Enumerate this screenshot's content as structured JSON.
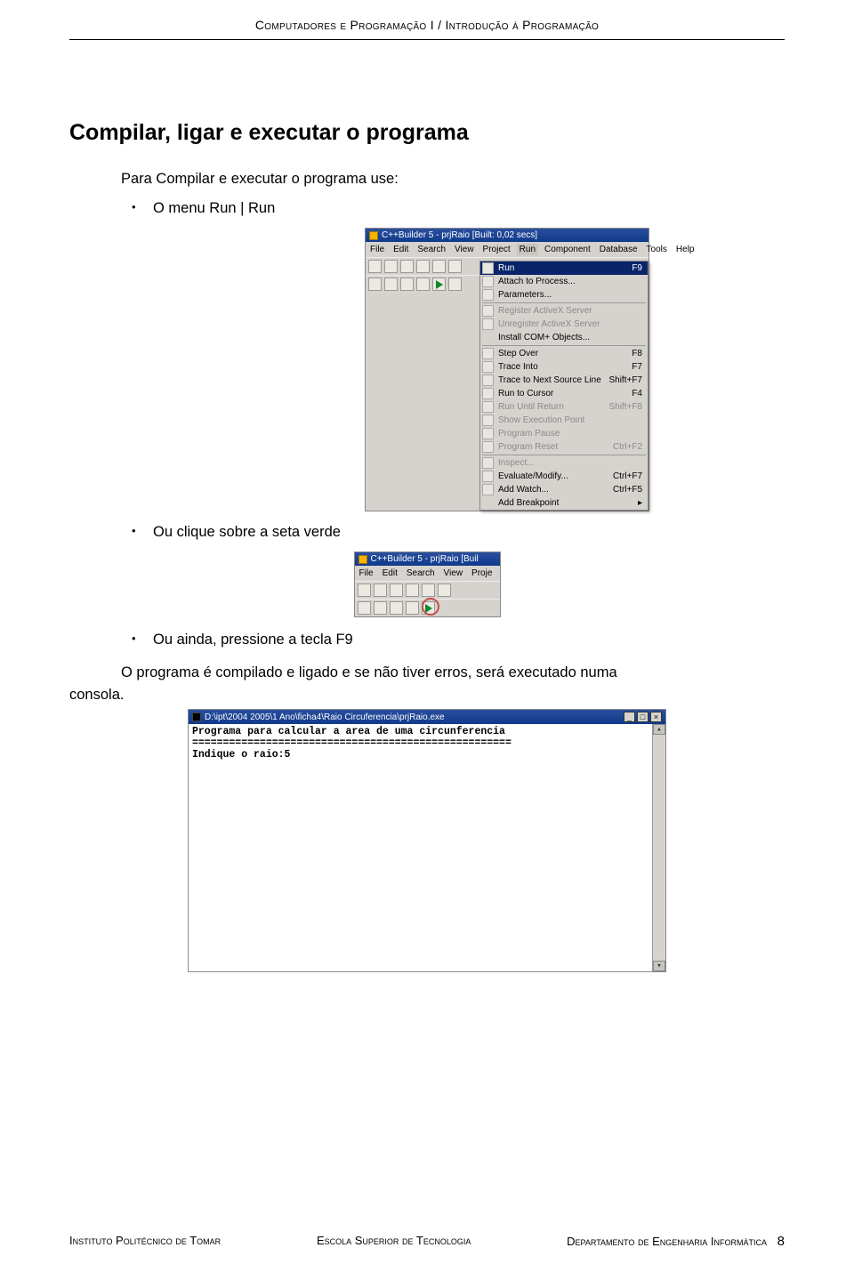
{
  "header": {
    "text": "Computadores e Programação I / Introdução à Programação"
  },
  "section": {
    "title": "Compilar, ligar e executar o programa",
    "intro": "Para Compilar e executar o programa use:",
    "bullet1": "O menu Run | Run",
    "bullet2": "Ou clique sobre a seta verde",
    "bullet3": "Ou ainda, pressione a tecla F9",
    "conclusion_pre": "O programa é compilado e ligado e se não tiver erros, será executado numa",
    "conclusion_last": "consola."
  },
  "runmenu": {
    "title": "C++Builder 5 - prjRaio [Built: 0,02 secs]",
    "menus": [
      "File",
      "Edit",
      "Search",
      "View",
      "Project",
      "Run",
      "Component",
      "Database",
      "Tools",
      "Help"
    ],
    "items": [
      {
        "label": "Run",
        "shortcut": "F9",
        "sel": true,
        "icon": true
      },
      {
        "label": "Attach to Process...",
        "icon": true
      },
      {
        "label": "Parameters...",
        "icon": true
      },
      {
        "sep": true
      },
      {
        "label": "Register ActiveX Server",
        "disabled": true,
        "icon": true
      },
      {
        "label": "Unregister ActiveX Server",
        "disabled": true,
        "icon": true
      },
      {
        "label": "Install COM+ Objects..."
      },
      {
        "sep": true
      },
      {
        "label": "Step Over",
        "shortcut": "F8",
        "icon": true
      },
      {
        "label": "Trace Into",
        "shortcut": "F7",
        "icon": true
      },
      {
        "label": "Trace to Next Source Line",
        "shortcut": "Shift+F7",
        "icon": true
      },
      {
        "label": "Run to Cursor",
        "shortcut": "F4",
        "icon": true
      },
      {
        "label": "Run Until Return",
        "shortcut": "Shift+F8",
        "disabled": true,
        "icon": true
      },
      {
        "label": "Show Execution Point",
        "disabled": true,
        "icon": true
      },
      {
        "label": "Program Pause",
        "disabled": true,
        "icon": true
      },
      {
        "label": "Program Reset",
        "shortcut": "Ctrl+F2",
        "disabled": true,
        "icon": true
      },
      {
        "sep": true
      },
      {
        "label": "Inspect...",
        "disabled": true,
        "icon": true
      },
      {
        "label": "Evaluate/Modify...",
        "shortcut": "Ctrl+F7",
        "icon": true
      },
      {
        "label": "Add Watch...",
        "shortcut": "Ctrl+F5",
        "icon": true
      },
      {
        "label": "Add Breakpoint",
        "arrow": true
      }
    ]
  },
  "smalltool": {
    "title": "C++Builder 5 - prjRaio [Buil",
    "menus": [
      "File",
      "Edit",
      "Search",
      "View",
      "Proje"
    ]
  },
  "console": {
    "title": "D:\\ipt\\2004 2005\\1 Ano\\ficha4\\Raio Circuferencia\\prjRaio.exe",
    "line1": "Programa para calcular a area de uma circunferencia",
    "line2": "====================================================",
    "line3": "Indique o raio:5"
  },
  "footer": {
    "left": "Instituto Politécnico de Tomar",
    "center": "Escola Superior de Tecnologia",
    "right": "Departamento de Engenharia Informática",
    "page": "8"
  }
}
